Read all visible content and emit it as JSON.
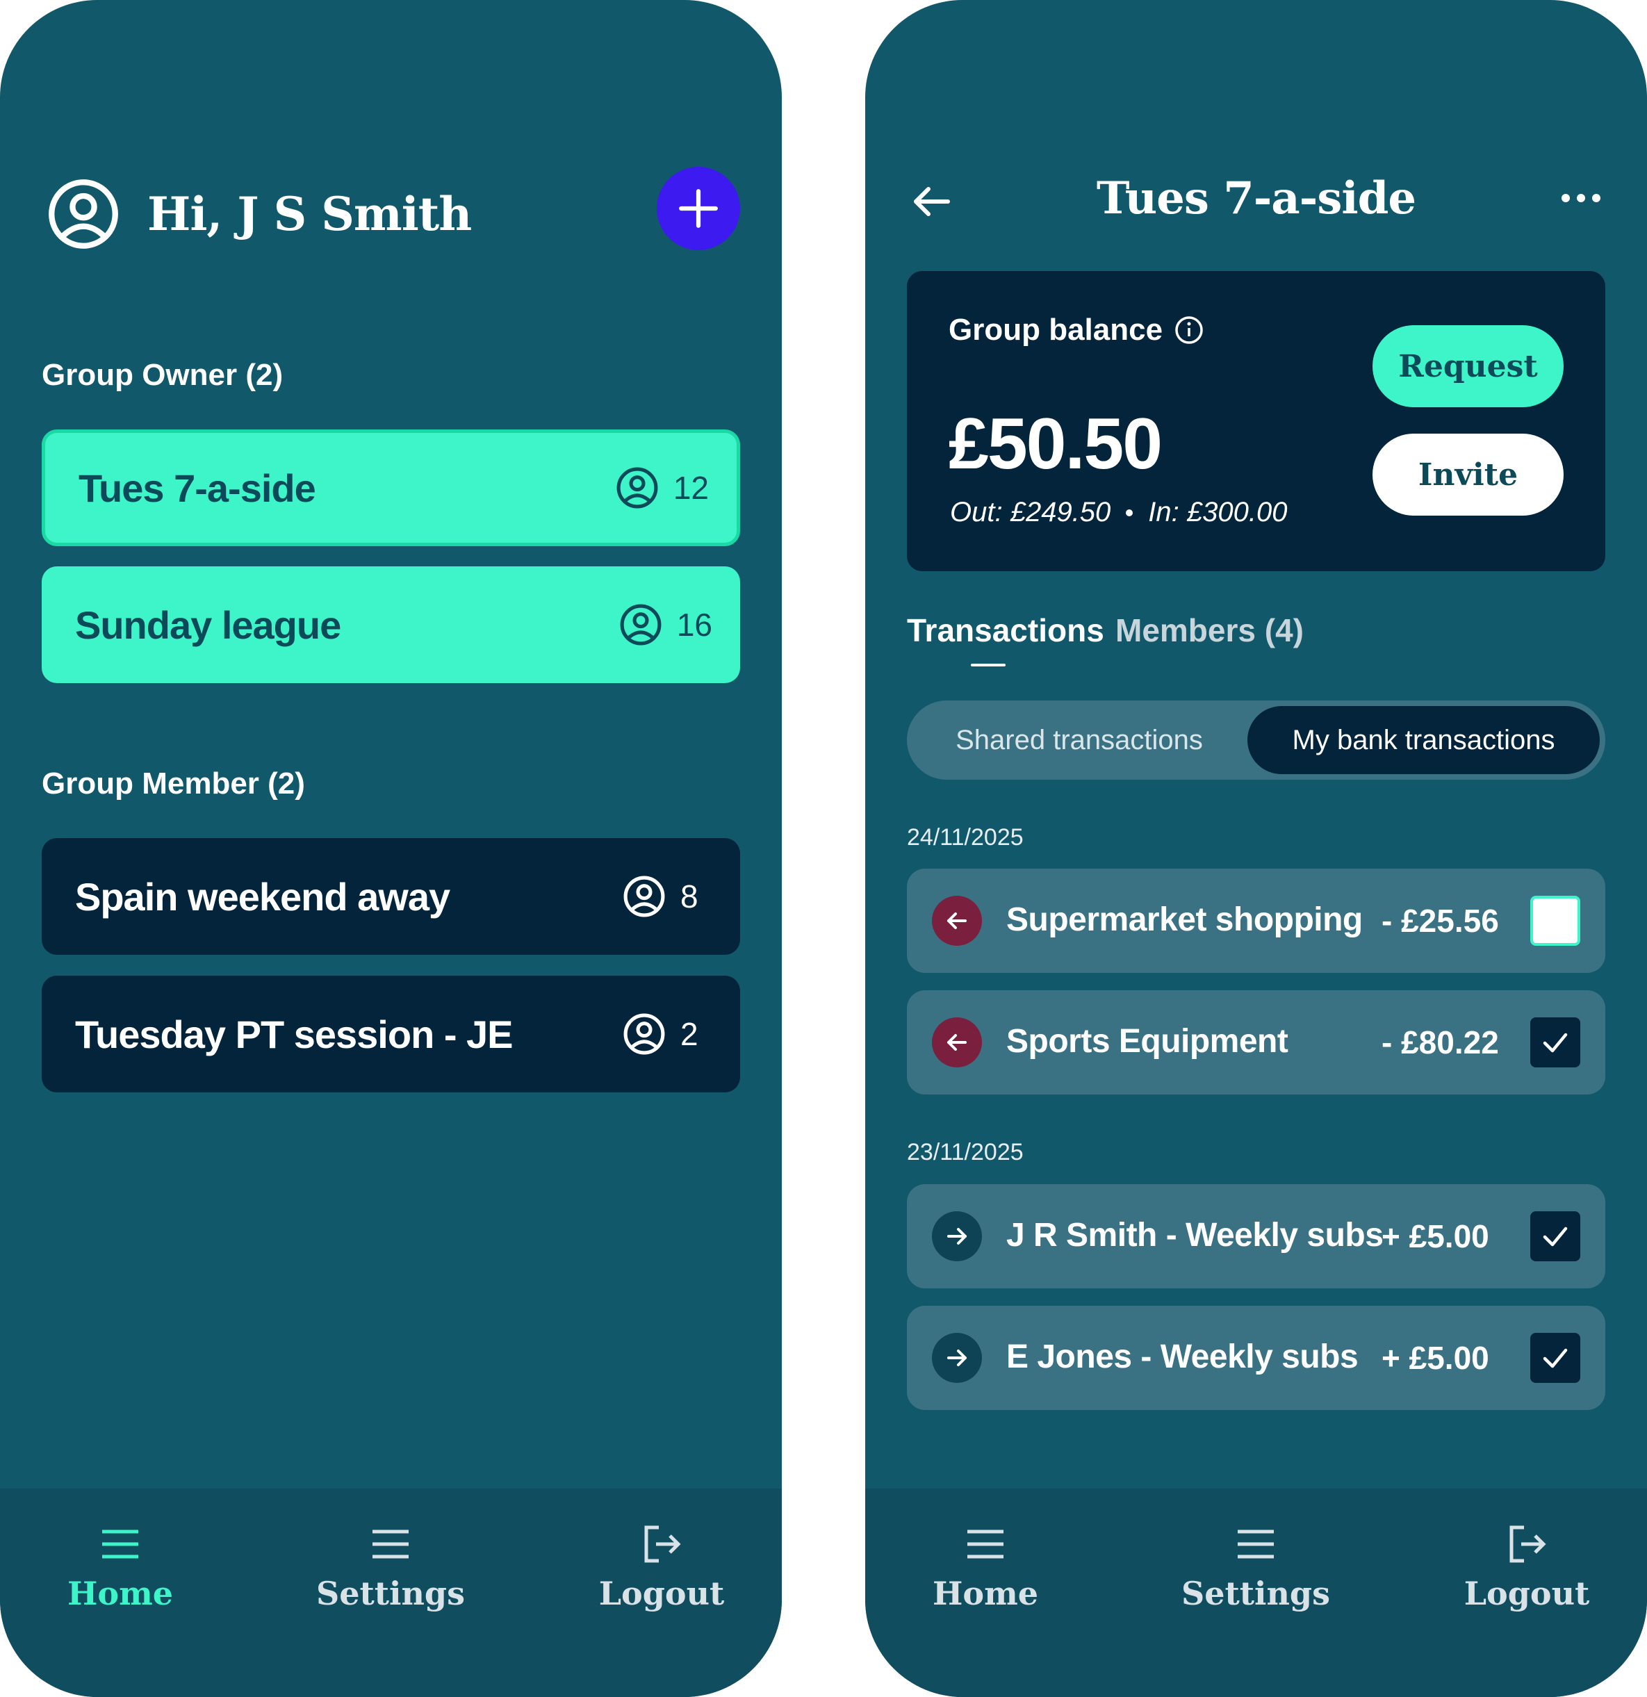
{
  "home": {
    "greeting": "Hi, J S Smith",
    "owner_section": "Group Owner (2)",
    "member_section": "Group Member (2)",
    "owner_groups": [
      {
        "name": "Tues 7-a-side",
        "count": "12"
      },
      {
        "name": "Sunday league",
        "count": "16"
      }
    ],
    "member_groups": [
      {
        "name": "Spain weekend away",
        "count": "8"
      },
      {
        "name": "Tuesday PT session - JE",
        "count": "2"
      }
    ]
  },
  "nav": {
    "home": "Home",
    "settings": "Settings",
    "logout": "Logout"
  },
  "group": {
    "title": "Tues 7-a-side",
    "balance_label": "Group balance",
    "balance": "£50.50",
    "out": "Out: £249.50",
    "in": "In: £300.00",
    "request": "Request",
    "invite": "Invite",
    "tabs": [
      "Transactions",
      "Members (4)"
    ],
    "segments": [
      "Shared transactions",
      "My bank transactions"
    ],
    "days": [
      {
        "date": "24/11/2025",
        "transactions": [
          {
            "name": "Supermarket shopping",
            "amount": "- £25.56",
            "direction": "out",
            "checked": false
          },
          {
            "name": "Sports Equipment",
            "amount": "- £80.22",
            "direction": "out",
            "checked": true
          }
        ]
      },
      {
        "date": "23/11/2025",
        "transactions": [
          {
            "name": "J R Smith - Weekly subs",
            "amount": "+ £5.00",
            "direction": "in",
            "checked": true
          },
          {
            "name": "E Jones - Weekly subs",
            "amount": "+ £5.00",
            "direction": "in",
            "checked": true
          }
        ]
      }
    ]
  },
  "colors": {
    "background": "#12586b",
    "accent": "#3df5c8",
    "card_dark": "#03243a",
    "add_button": "#3d1af0",
    "out_icon": "#7a1f3e"
  },
  "icons": {
    "avatar": "user-circle-icon",
    "add": "plus-icon",
    "menu": "hamburger-icon",
    "logout": "logout-icon",
    "back": "arrow-left-icon",
    "more": "ellipsis-icon",
    "info": "info-icon",
    "check": "check-icon"
  }
}
